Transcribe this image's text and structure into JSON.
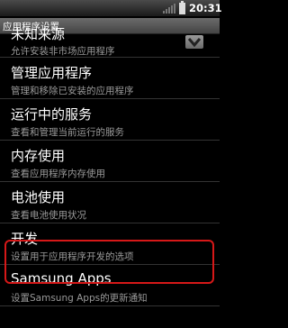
{
  "status_bar": {
    "time": "20:31",
    "signal_icon": "signal-bars-icon",
    "battery_icon": "battery-icon"
  },
  "title_bar": {
    "title": "应用程序设置"
  },
  "items": [
    {
      "label": "未知来源",
      "summary": "允许安装非市场应用程序",
      "checkbox": "checked"
    },
    {
      "label": "管理应用程序",
      "summary": "管理和移除已安装的应用程序"
    },
    {
      "label": "运行中的服务",
      "summary": "查看和管理当前运行的服务"
    },
    {
      "label": "内存使用",
      "summary": "查看应用程序内存使用"
    },
    {
      "label": "电池使用",
      "summary": "查看电池使用状况"
    },
    {
      "label": "开发",
      "summary": "设置用于应用程序开发的选项"
    },
    {
      "label": "Samsung Apps",
      "summary": "设置Samsung Apps的更新通知"
    }
  ],
  "colors": {
    "highlight": "#d61818",
    "summary_text": "#9a9a9a"
  }
}
